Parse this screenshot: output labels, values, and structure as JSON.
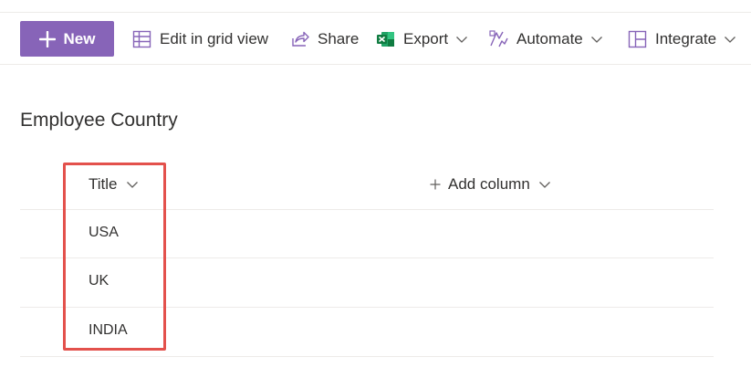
{
  "toolbar": {
    "new_label": "New",
    "edit_grid_label": "Edit in grid view",
    "share_label": "Share",
    "export_label": "Export",
    "automate_label": "Automate",
    "integrate_label": "Integrate"
  },
  "list": {
    "title": "Employee Country",
    "columns": {
      "title_label": "Title",
      "add_column_label": "Add column"
    },
    "rows": [
      "USA",
      "UK",
      "INDIA"
    ]
  },
  "colors": {
    "accent": "#8764b8",
    "highlight": "#e3514c",
    "excel_green": "#107c41"
  },
  "icons": {
    "new": "plus-icon",
    "edit_grid": "grid-icon",
    "share": "share-icon",
    "export": "excel-icon",
    "automate": "automate-icon",
    "integrate": "integrate-icon"
  }
}
